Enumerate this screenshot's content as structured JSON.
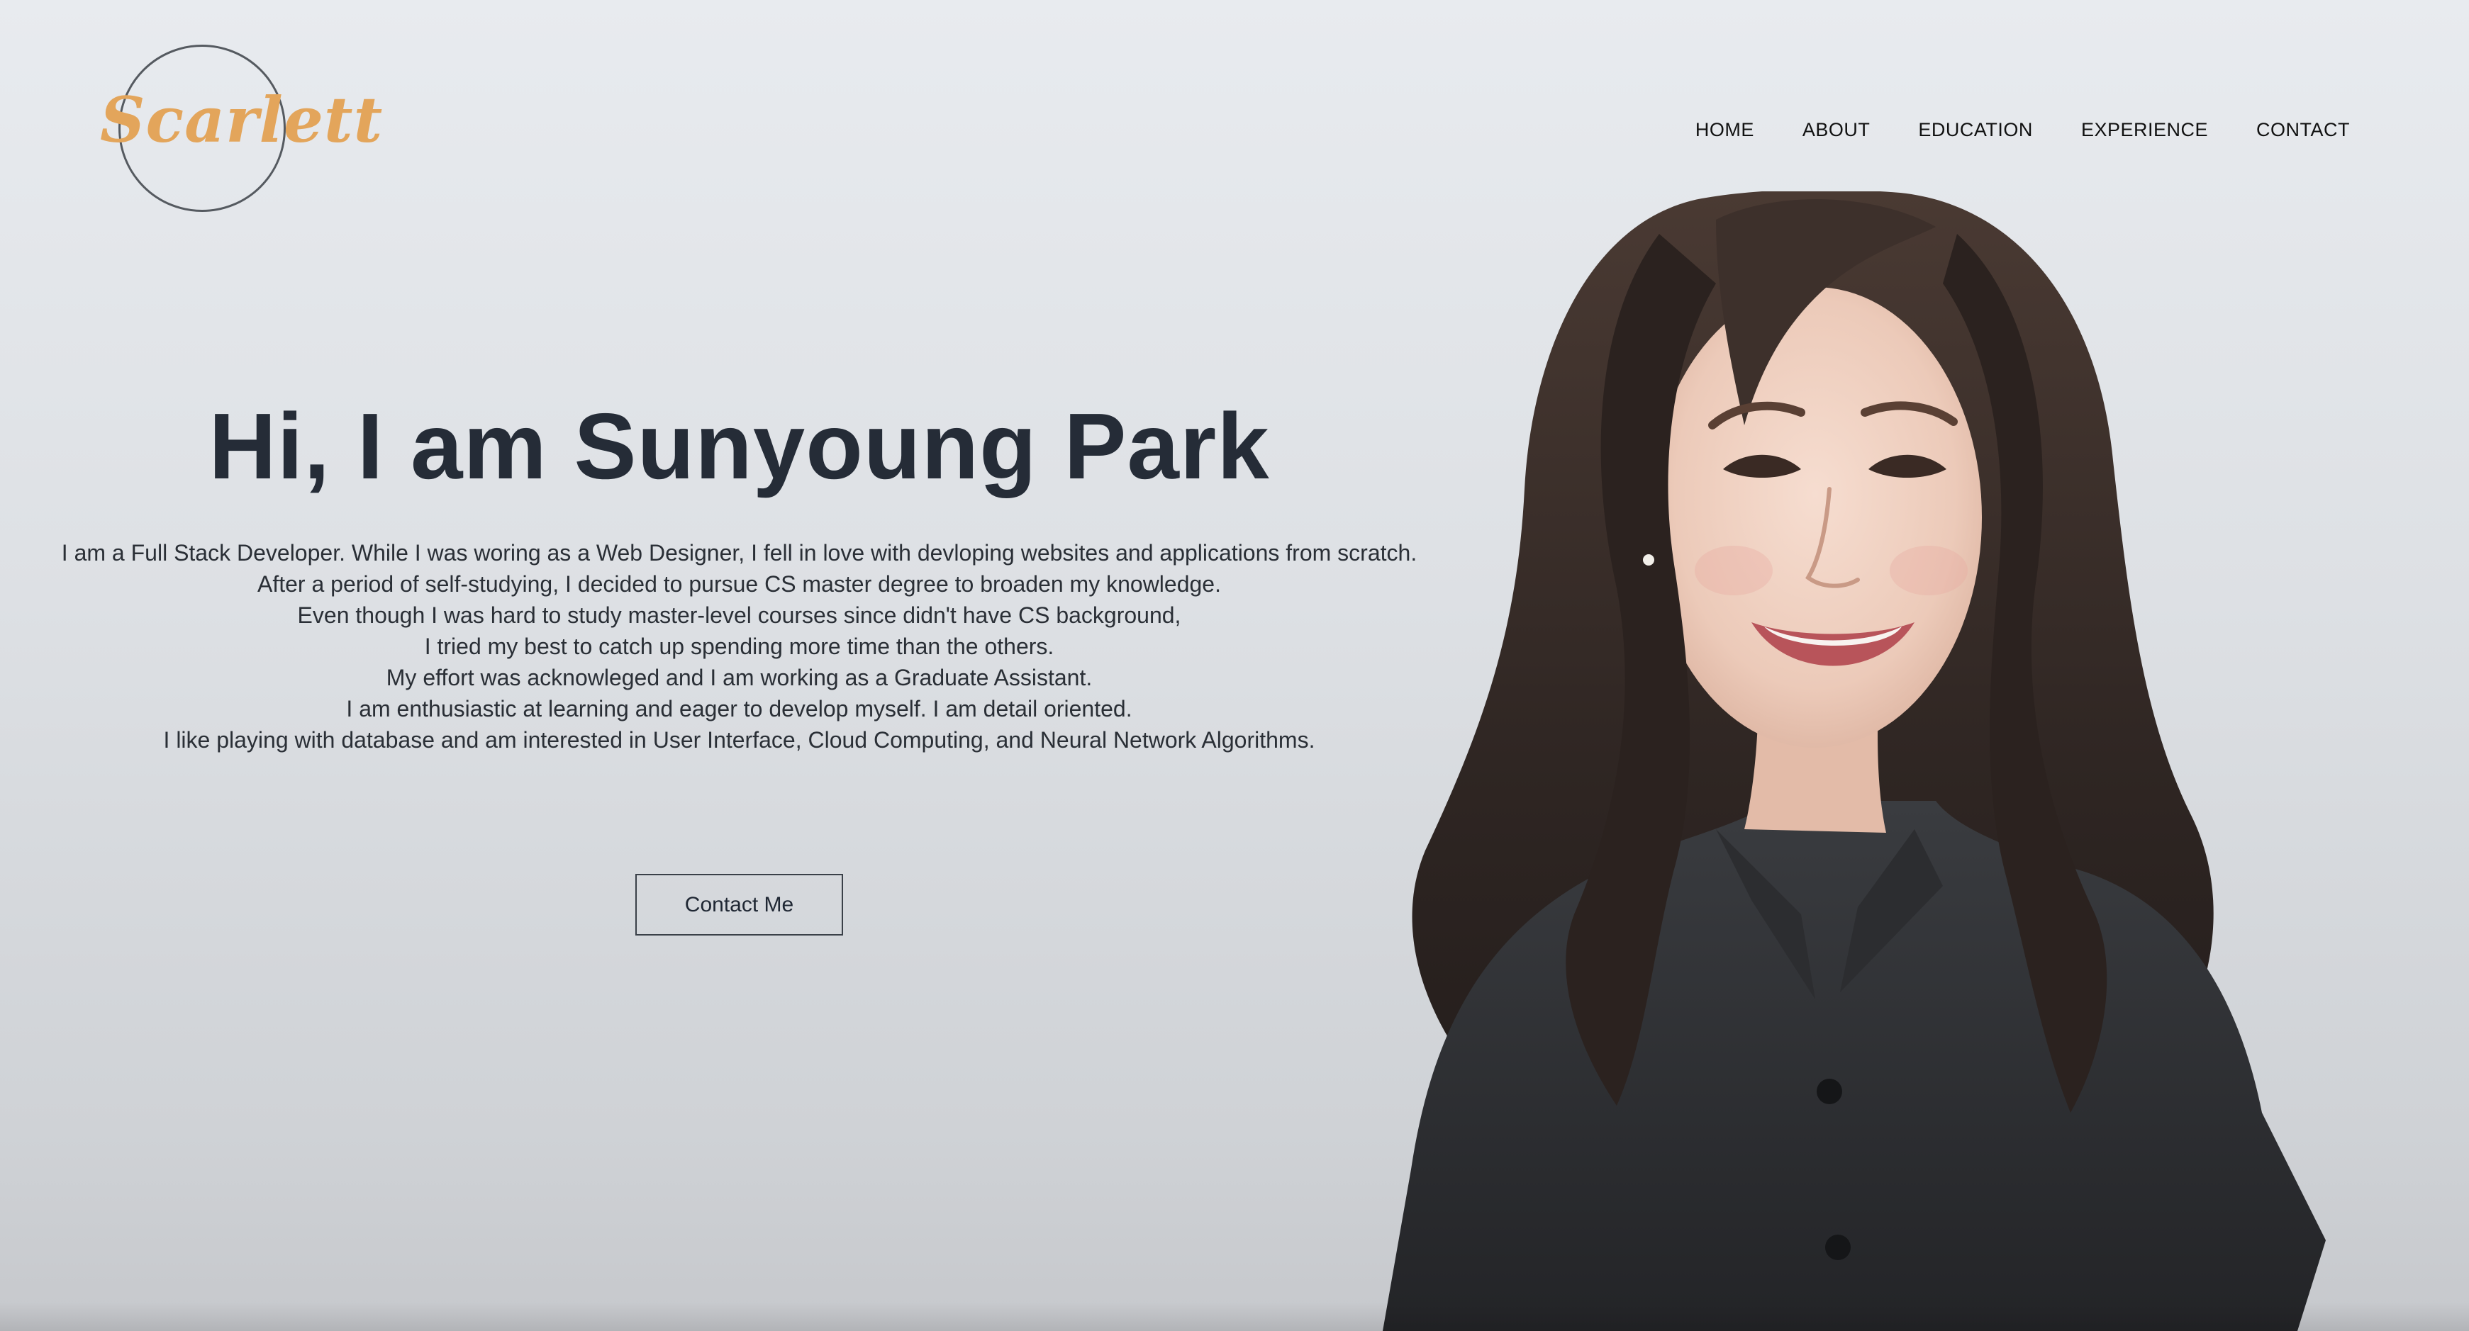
{
  "logo": {
    "text": "Scarlett"
  },
  "nav": {
    "items": [
      {
        "label": "HOME"
      },
      {
        "label": "ABOUT"
      },
      {
        "label": "EDUCATION"
      },
      {
        "label": "EXPERIENCE"
      },
      {
        "label": "CONTACT"
      }
    ]
  },
  "hero": {
    "title": "Hi, I am Sunyoung Park",
    "bio_lines": [
      "I am a Full Stack Developer. While I was woring as a Web Designer, I fell in love with devloping websites and applications from scratch.",
      "After a period of self-studying, I decided to pursue CS master degree to broaden my knowledge.",
      "Even though I was hard to study master-level courses since didn't have CS background,",
      "I tried my best to catch up spending more time than the others.",
      "My effort was acknowleged and I am working as a Graduate Assistant.",
      "I am enthusiastic at learning and eager to develop myself. I am detail oriented.",
      "I like playing with database and am interested in User Interface, Cloud Computing, and Neural Network Algorithms."
    ],
    "button_label": "Contact Me"
  },
  "colors": {
    "logo_accent": "#e3a55b",
    "title": "#252c37",
    "background": "#e2e5e9"
  }
}
